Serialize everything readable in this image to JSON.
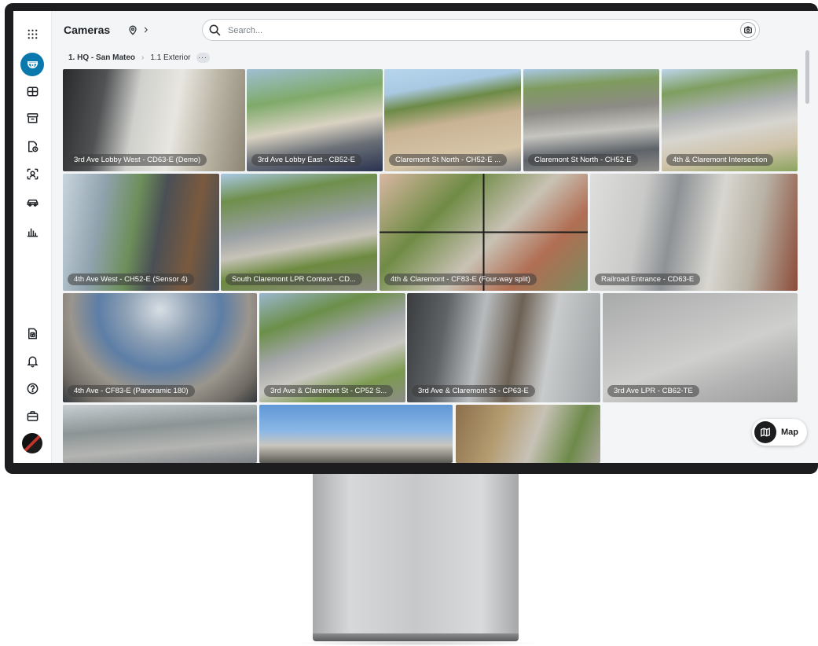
{
  "app": {
    "title": "Cameras"
  },
  "search": {
    "placeholder": "Search..."
  },
  "breadcrumb": {
    "site": "1. HQ - San Mateo",
    "folder": "1.1 Exterior",
    "more": "···"
  },
  "map_button": {
    "label": "Map"
  },
  "rail": {
    "top_icons": [
      "camera-dome-icon",
      "grid-icon",
      "archive-icon",
      "access-icon",
      "face-search-icon",
      "vehicle-icon",
      "analytics-icon"
    ],
    "bottom_icons": [
      "report-icon",
      "bell-icon",
      "help-icon",
      "briefcase-icon"
    ]
  },
  "colors": {
    "accent": "#0a78ad",
    "rail_bg": "#ffffff",
    "screen_bg": "#f3f5f7"
  },
  "cameras": [
    {
      "label": "3rd Ave Lobby West - CD63-E (Demo)"
    },
    {
      "label": "3rd Ave Lobby East - CB52-E"
    },
    {
      "label": "Claremont St North - CH52-E ..."
    },
    {
      "label": "Claremont St North - CH52-E"
    },
    {
      "label": "4th & Claremont Intersection"
    },
    {
      "label": "4th Ave West - CH52-E (Sensor 4)"
    },
    {
      "label": "South Claremont LPR Context - CD..."
    },
    {
      "label": "4th & Claremont - CF83-E (Four-way split)"
    },
    {
      "label": "Railroad Entrance - CD63-E"
    },
    {
      "label": "4th Ave - CF83-E (Panoramic 180)"
    },
    {
      "label": "3rd Ave & Claremont St - CP52 S..."
    },
    {
      "label": "3rd Ave & Claremont St - CP63-E"
    },
    {
      "label": "3rd Ave LPR - CB62-TE"
    },
    {
      "label": ""
    },
    {
      "label": ""
    },
    {
      "label": ""
    }
  ]
}
